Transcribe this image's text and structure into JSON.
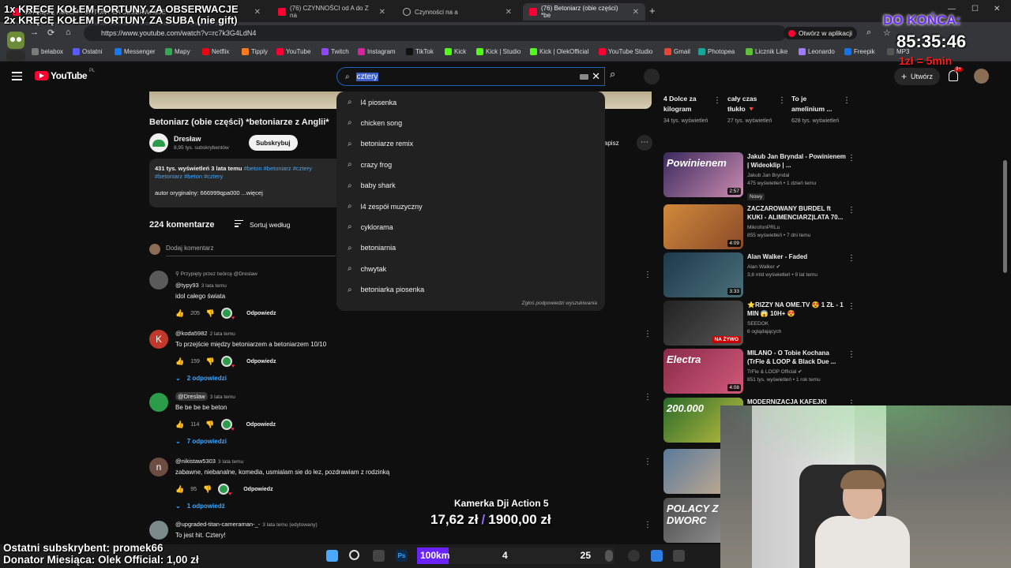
{
  "browser": {
    "tabs": [
      {
        "title": "1x KRĘCĘ KOŁEM FORTUNY ZA OBSERWACJE",
        "active": false
      },
      {
        "title": "(76) CZYNNOŚCI od A do Z na",
        "active": false
      },
      {
        "title": "Czynności na a",
        "active": false
      },
      {
        "title": "(76) Betoniarz (obie części) *be",
        "active": true
      }
    ],
    "url": "https://www.youtube.com/watch?v=rc7k3G4LdN4",
    "open_in_app": "Otwórz w aplikacji",
    "bookmarks": [
      {
        "label": "belabox",
        "color": "#7a7a7a"
      },
      {
        "label": "Ostatni",
        "color": "#5b5bff"
      },
      {
        "label": "Messenger",
        "color": "#1877f2"
      },
      {
        "label": "Mapy",
        "color": "#34a853"
      },
      {
        "label": "Netflix",
        "color": "#e50914"
      },
      {
        "label": "Tipply",
        "color": "#ff7a1a"
      },
      {
        "label": "YouTube",
        "color": "#ff0033"
      },
      {
        "label": "Twitch",
        "color": "#9146ff"
      },
      {
        "label": "Instagram",
        "color": "#d6249f"
      },
      {
        "label": "TikTok",
        "color": "#111111"
      },
      {
        "label": "Kick",
        "color": "#53fc18"
      },
      {
        "label": "Kick | Studio",
        "color": "#53fc18"
      },
      {
        "label": "Kick | OlekOfficial",
        "color": "#53fc18"
      },
      {
        "label": "YouTube Studio",
        "color": "#ff0033"
      },
      {
        "label": "Gmail",
        "color": "#ea4335"
      },
      {
        "label": "Photopea",
        "color": "#18a497"
      },
      {
        "label": "Licznik Like",
        "color": "#5fbf3b"
      },
      {
        "label": "Leonardo",
        "color": "#a07bff"
      },
      {
        "label": "Freepik",
        "color": "#1273eb"
      },
      {
        "label": "MP3",
        "color": "#555555"
      }
    ]
  },
  "youtube": {
    "logo_text": "YouTube",
    "country": "PL",
    "search_value": "cztery",
    "create_label": "Utwórz",
    "notif_count": "9+",
    "suggestions": [
      "l4 piosenka",
      "chicken song",
      "betoniarze remix",
      "crazy frog",
      "baby shark",
      "l4 zespół muzyczny",
      "cyklorama",
      "betoniarnia",
      "chwytak",
      "betoniarka piosenka"
    ],
    "suggest_report": "Zgłoś podpowiedzi wyszukiwania"
  },
  "video": {
    "title": "Betoniarz (obie części) *betoniarze z Anglii*",
    "channel": "Dresław",
    "subscribers": "8,95 tys. subskrybentów",
    "subscribe_label": "Subskrybuj",
    "save_label": "Zapisz",
    "views": "431 tys. wyświetleń",
    "age": "3 lata temu",
    "tags_line1": "#beton #betoniarz #cztery",
    "tags_line2": "#betoniarz #beton #cztery",
    "original_author": "autor oryginalny: 666999qpa000 ...więcej"
  },
  "comments": {
    "count_label": "224 komentarze",
    "sort_label": "Sortuj według",
    "add_placeholder": "Dodaj komentarz",
    "reply_label": "Odpowiedz",
    "pinned_note": "Przypięty przez twórcę @Dreslaw",
    "items": [
      {
        "author": "@typy93",
        "time": "3 lata temu",
        "text": "idol całego świata",
        "likes": "205",
        "avatar": "",
        "avatar_color": "#5a5a5a",
        "replies": ""
      },
      {
        "author": "@koda5982",
        "time": "2 lata temu",
        "text": "To przejście między betoniarzem a betoniarzem 10/10",
        "likes": "159",
        "avatar": "K",
        "avatar_color": "#c0392b",
        "replies": "2 odpowiedzi"
      },
      {
        "author": "@Dreslaw",
        "time": "3 lata temu",
        "text": "Be be be be beton",
        "likes": "114",
        "avatar": "",
        "avatar_color": "#2a9c4a",
        "replies": "7 odpowiedzi"
      },
      {
        "author": "@nikistaw5303",
        "time": "3 lata temu",
        "text": "zabawne, niebanalne, komedia, usmialam sie do łez, pozdrawiam z rodzinką",
        "likes": "95",
        "avatar": "n",
        "avatar_color": "#6d4c41",
        "replies": "1 odpowiedź"
      },
      {
        "author": "@upgraded-titan-cameraman-_-",
        "time": "3 lata temu (edytowany)",
        "text": "To jest hit. Cztery!",
        "likes": "",
        "avatar": "",
        "avatar_color": "#7a8a8a",
        "replies": ""
      }
    ]
  },
  "sidebar": {
    "shorts": [
      {
        "title": "4 Dolce za kilogram",
        "meta": "34 tys. wyświetleń"
      },
      {
        "title": "cały czas tłukło 🔻",
        "meta": "27 tys. wyświetleń"
      },
      {
        "title": "To je amelinium ...",
        "meta": "628 tys. wyświetleń"
      }
    ],
    "recs": [
      {
        "title": "Jakub Jan Bryndal - Powinienem | Wideoklip | ...",
        "channel": "Jakub Jan Bryndal",
        "meta": "475 wyświetleń • 1 dzień temu",
        "badge": "Nowy",
        "duration": "2:57",
        "thumb_text": "Powinienem",
        "colors": [
          "#3b2a5e",
          "#c98bb0"
        ]
      },
      {
        "title": "ZACZAROWANY BURDEL ft KUKI - ALIMENCIARZ|LATA 70...",
        "channel": "MikrofonPRLu",
        "meta": "855 wyświetleń • 7 dni temu",
        "badge": "",
        "duration": "4:09",
        "thumb_text": "",
        "colors": [
          "#d08a3a",
          "#8a4a2a"
        ]
      },
      {
        "title": "Alan Walker - Faded",
        "channel": "Alan Walker ✔",
        "meta": "3,8 mld wyświetleń • 9 lat temu",
        "badge": "",
        "duration": "3:33",
        "thumb_text": "",
        "colors": [
          "#1d3a4a",
          "#4a6f7a"
        ]
      },
      {
        "title": "⭐RIZZY NA OME.TV 😍 1 ZŁ - 1 MIN 😱 10H+ 😍",
        "channel": "SEEDOK",
        "meta": "6 oglądających",
        "badge": "",
        "duration": "",
        "live": "NA ŻYWO",
        "thumb_text": "",
        "colors": [
          "#222",
          "#555"
        ]
      },
      {
        "title": "MILANO - O Tobie Kochana (TrFle & LOOP & Black Due ...",
        "channel": "TrFle & LOOP Official ✔",
        "meta": "851 tys. wyświetleń • 1 rok temu",
        "badge": "",
        "duration": "4:08",
        "thumb_text": "Electra",
        "colors": [
          "#8a2a4a",
          "#d05a7a"
        ]
      },
      {
        "title": "MODERNIZACJA KAFEJKI",
        "channel": "",
        "meta": "",
        "badge": "",
        "duration": "",
        "thumb_text": "200.000",
        "colors": [
          "#2a6a2a",
          "#c0c040"
        ]
      },
      {
        "title": "",
        "channel": "",
        "meta": "",
        "badge": "",
        "duration": "",
        "thumb_text": "",
        "colors": [
          "#5a7a9a",
          "#d0b090"
        ]
      },
      {
        "title": "",
        "channel": "",
        "meta": "",
        "badge": "",
        "duration": "",
        "thumb_text": "POLACY Z DWORC",
        "colors": [
          "#4a4a4a",
          "#9a9a9a"
        ]
      }
    ]
  },
  "overlay": {
    "line1": "1x KRĘCĘ KOŁEM FORTUNY ZA OBSERWACJE",
    "line2": "2x KRĘCĘ KOŁEM FORTUNY ZA SUBA (nie gift)",
    "countdown_label": "DO KOŃCA:",
    "countdown": "85:35:46",
    "rate": "1zł = 5min",
    "goal_title": "Kamerka Dji Action 5",
    "goal_current": "17,62 zł",
    "goal_target": "1900,00 zł",
    "last_sub": "Ostatni subskrybent: promek66",
    "donor": "Donator Miesiąca: Olek Official: 1,00 zł",
    "km_label": "100km",
    "km_mid": "4",
    "km_end": "25",
    "km_progress": 0.16
  }
}
